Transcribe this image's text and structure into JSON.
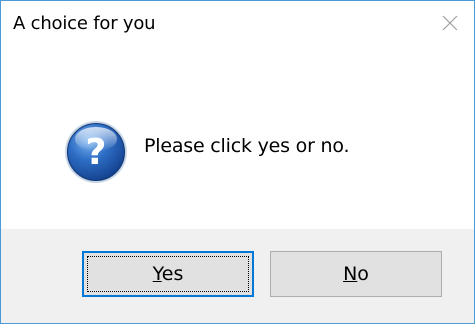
{
  "window": {
    "title": "A choice for you",
    "close_icon": "close-icon"
  },
  "message": {
    "icon": "question-icon",
    "text": "Please click yes or no."
  },
  "buttons": {
    "yes": {
      "label_mnemonic": "Y",
      "label_rest": "es",
      "is_default": true
    },
    "no": {
      "label_mnemonic": "N",
      "label_rest": "o",
      "is_default": false
    }
  },
  "colors": {
    "window_border": "#4a9ad8",
    "footer_bg": "#f0f0f0",
    "button_bg": "#e1e1e1",
    "default_button_border": "#0078d7",
    "icon_blue": "#1f5fb4"
  }
}
